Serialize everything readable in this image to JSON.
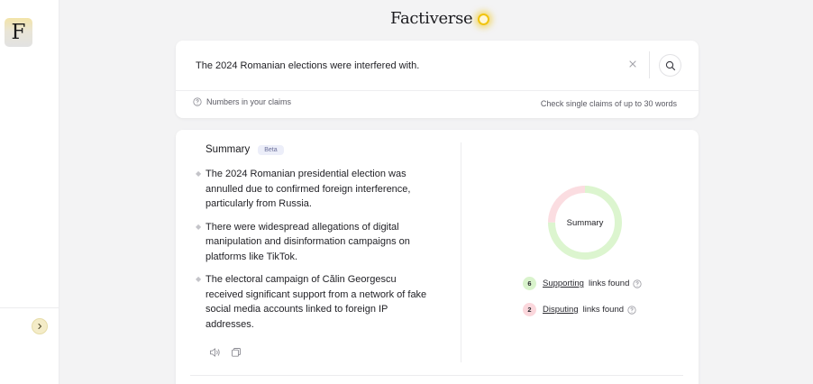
{
  "sidebar": {
    "logo_letter": "F"
  },
  "brand": {
    "name": "Factiverse"
  },
  "search": {
    "query": "The 2024 Romanian elections were interfered with.",
    "hint_numbers": "Numbers in your claims",
    "hint_limit": "Check single claims of up to 30 words"
  },
  "summary": {
    "title": "Summary",
    "badge": "Beta",
    "bullets": [
      "The 2024 Romanian presidential election was annulled due to confirmed foreign interference, particularly from Russia.",
      "There were widespread allegations of digital manipulation and disinformation campaigns on platforms like TikTok.",
      "The electoral campaign of Călin Georgescu received significant support from a network of fake social media accounts linked to foreign IP addresses."
    ]
  },
  "verdict": {
    "donut_label": "Summary",
    "supporting": {
      "count": "6",
      "label": "Supporting",
      "suffix": "links found"
    },
    "disputing": {
      "count": "2",
      "label": "Disputing",
      "suffix": "links found"
    }
  },
  "colors": {
    "supporting": "#dcf5cf",
    "disputing": "#fbdde1",
    "accent": "#f1c40f"
  },
  "icons": {
    "logo": "factiverse-logo",
    "expand": "chevron-right-icon",
    "clear": "close-icon",
    "search": "search-icon",
    "help": "help-circle-icon",
    "speaker": "speaker-icon",
    "copy": "copy-icon"
  }
}
